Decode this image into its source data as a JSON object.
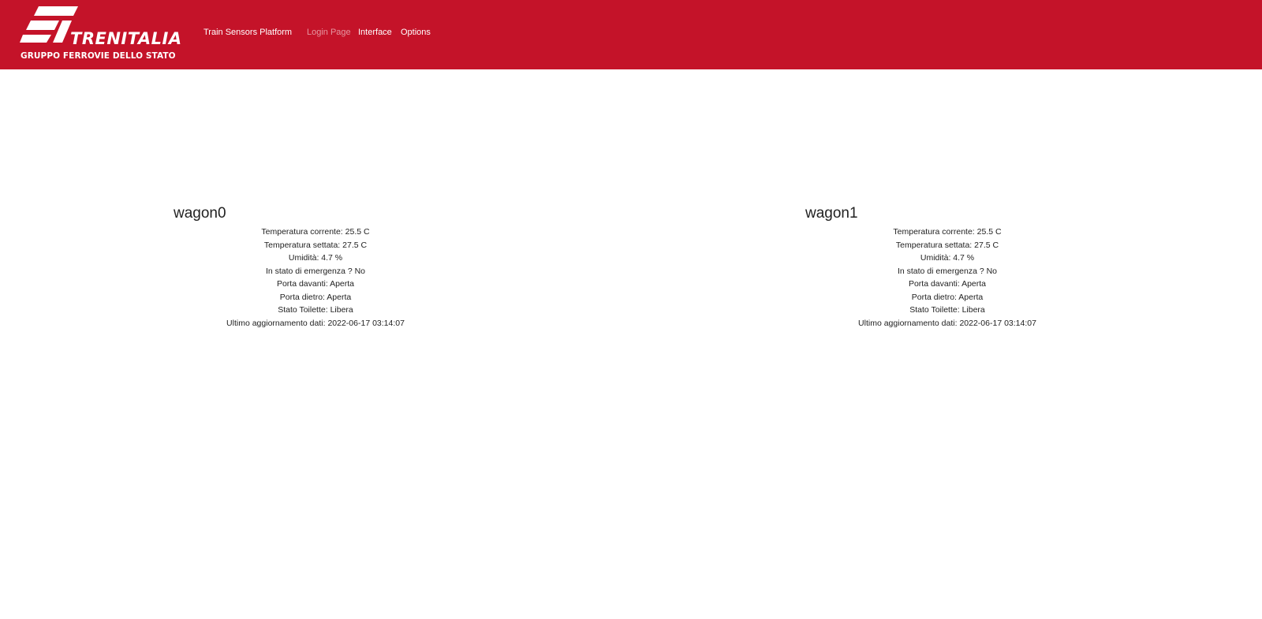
{
  "navbar": {
    "background_color": "#c41329",
    "logo": {
      "icon": "fs-logo-icon",
      "wordmark": "TRENITALIA",
      "subtitle": "GRUPPO FERROVIE DELLO STATO"
    },
    "brand": "Train Sensors Platform",
    "links": {
      "login": "Login Page",
      "interface": "Interface",
      "options": "Options"
    }
  },
  "wagons": [
    {
      "name": "wagon0",
      "temp_current": "Temperatura corrente: 25.5 C",
      "temp_set": "Temperatura settata: 27.5 C",
      "humidity": "Umidità: 4.7 %",
      "emergency": "In stato di emergenza ? No",
      "front_door": "Porta davanti: Aperta",
      "back_door": "Porta dietro: Aperta",
      "toilet": "Stato Toilette: Libera",
      "last_update": "Ultimo aggiornamento dati: 2022-06-17 03:14:07"
    },
    {
      "name": "wagon1",
      "temp_current": "Temperatura corrente: 25.5 C",
      "temp_set": "Temperatura settata: 27.5 C",
      "humidity": "Umidità: 4.7 %",
      "emergency": "In stato di emergenza ? No",
      "front_door": "Porta davanti: Aperta",
      "back_door": "Porta dietro: Aperta",
      "toilet": "Stato Toilette: Libera",
      "last_update": "Ultimo aggiornamento dati: 2022-06-17 03:14:07"
    }
  ]
}
